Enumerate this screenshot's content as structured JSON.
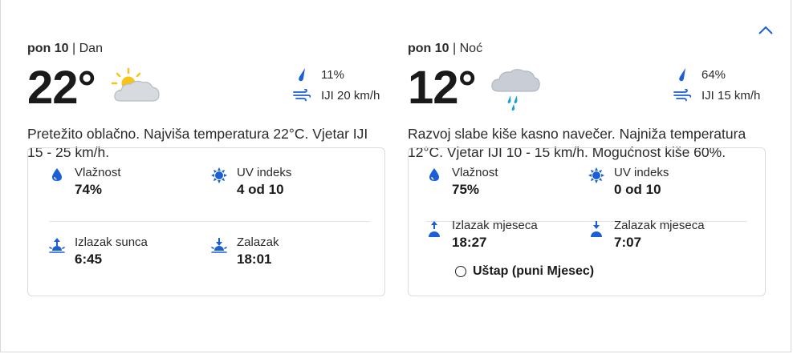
{
  "colors": {
    "accent": "#1a5fd6",
    "sun": "#f5c518",
    "cloud": "#c9ced6"
  },
  "day": {
    "date": "pon 10",
    "period": "Dan",
    "temp": "22°",
    "icon": "partly-cloudy-sun-icon",
    "precip": "11%",
    "wind": "IJI 20 km/h",
    "description": "Pretežito oblačno. Najviša temperatura 22°C. Vjetar IJI 15 - 25 km/h.",
    "details": {
      "humidity_label": "Vlažnost",
      "humidity": "74%",
      "uv_label": "UV indeks",
      "uv": "4 od 10",
      "rise_label": "Izlazak sunca",
      "rise": "6:45",
      "set_label": "Zalazak",
      "set": "18:01"
    }
  },
  "night": {
    "date": "pon 10",
    "period": "Noć",
    "temp": "12°",
    "icon": "rain-cloud-icon",
    "precip": "64%",
    "wind": "IJI 15 km/h",
    "description": "Razvoj slabe kiše kasno navečer. Najniža temperatura 12°C. Vjetar IJI 10 - 15 km/h. Mogućnost kiše 60%.",
    "details": {
      "humidity_label": "Vlažnost",
      "humidity": "75%",
      "uv_label": "UV indeks",
      "uv": "0 od 10",
      "rise_label": "Izlazak mjeseca",
      "rise": "18:27",
      "set_label": "Zalazak mjeseca",
      "set": "7:07",
      "moon_phase": "Uštap (puni Mjesec)"
    }
  }
}
